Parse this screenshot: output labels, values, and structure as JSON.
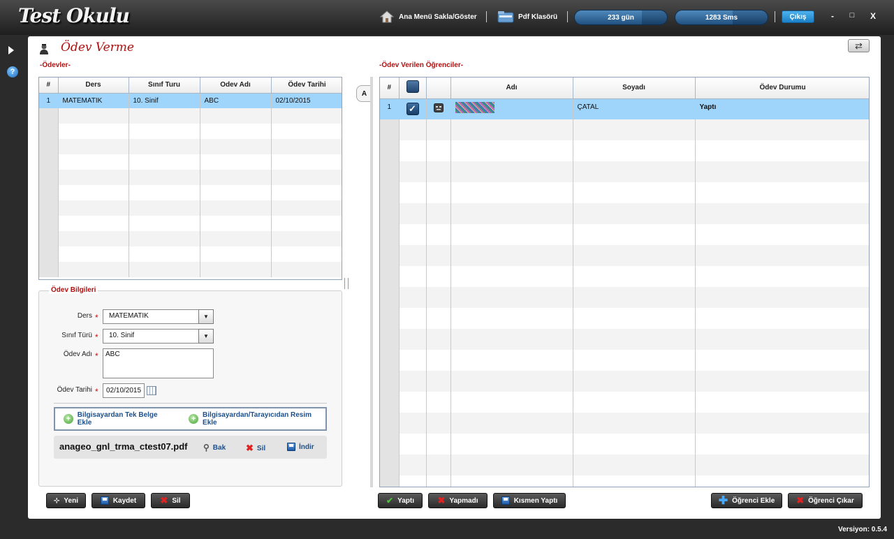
{
  "app": {
    "logo": "Test Okulu",
    "menu_toggle_label": "Ana Menü Sakla/Göster",
    "pdf_label": "Pdf Klasörü",
    "days_label": "233 gün",
    "days_fill": 0.73,
    "sms_label": "1283 Sms",
    "sms_fill": 0.62,
    "exit_label": "Çıkış",
    "minimize": "-",
    "maximize": "□",
    "close": "X",
    "version": "Versiyon: 0.5.4"
  },
  "sidebar": {
    "help": "?"
  },
  "page": {
    "title": "Ödev Verme"
  },
  "assignments": {
    "section_label": "-Ödevler-",
    "columns": [
      "#",
      "Ders",
      "Sınıf Turu",
      "Odev Adı",
      "Ödev Tarihi"
    ],
    "rows": [
      {
        "num": "1",
        "ders": "MATEMATIK",
        "sinif": "10. Sinif",
        "odev": "ABC",
        "tarih": "02/10/2015"
      }
    ]
  },
  "form": {
    "legend": "Ödev Bilgileri",
    "ders_label": "Ders",
    "ders_value": "MATEMATIK",
    "sinif_label": "Sınıf Türü",
    "sinif_value": "10. Sinif",
    "odev_label": "Ödev Adı",
    "odev_value": "ABC",
    "tarih_label": "Ödev Tarihi",
    "tarih_value": "02/10/2015",
    "required_mark": "*",
    "upload_doc": "Bilgisayardan Tek Belge Ekle",
    "upload_img": "Bilgisayardan/Tarayıcıdan Resim Ekle",
    "file_name": "anageo_gnl_trma_ctest07.pdf",
    "view_label": "Bak",
    "delete_label": "Sil",
    "download_label": "İndir"
  },
  "students": {
    "section_label": "-Ödev Verilen Öğrenciler-",
    "collapse_tab": "A",
    "columns": [
      "#",
      "",
      "",
      "Adı",
      "Soyadı",
      "Ödev Durumu"
    ],
    "rows": [
      {
        "num": "1",
        "checked": true,
        "soyadi": "ÇATAL",
        "durum": "Yaptı"
      }
    ]
  },
  "buttons": {
    "new": "Yeni",
    "save": "Kaydet",
    "delete": "Sil",
    "did": "Yaptı",
    "did_not": "Yapmadı",
    "partial": "Kısmen Yaptı",
    "add_student": "Öğrenci Ekle",
    "remove_student": "Öğrenci Çıkar"
  }
}
